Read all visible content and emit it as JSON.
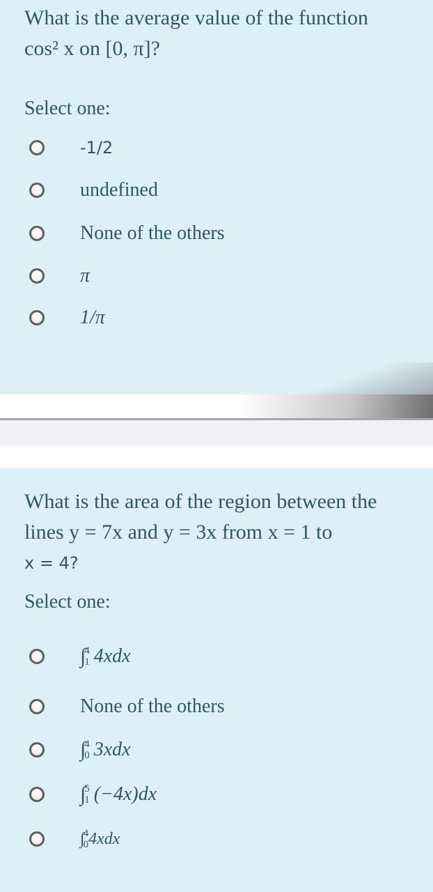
{
  "questions": [
    {
      "text_prefix": "What is the average value of the function",
      "text_math": "cos² x on [0, π]?",
      "select_label": "Select one:",
      "options": [
        {
          "label": "-1/2"
        },
        {
          "label": "undefined"
        },
        {
          "label": "None of the others"
        },
        {
          "label": "π"
        },
        {
          "label": "1/π"
        }
      ]
    },
    {
      "text_line1": "What is the area of the region between the",
      "text_line2": "lines y = 7x and y = 3x from x = 1 to",
      "text_line3": "x = 4?",
      "select_label": "Select one:",
      "options": [
        {
          "sign": "∫",
          "upper": "4",
          "lower": "1",
          "body": "4xdx"
        },
        {
          "label": "None of the others"
        },
        {
          "sign": "∫",
          "upper": "4",
          "lower": "0",
          "body": "3xdx"
        },
        {
          "sign": "∫",
          "upper": "5",
          "lower": "1",
          "body": "(−4x)dx"
        },
        {
          "sign": "∫",
          "upper": "4",
          "lower": "0",
          "body": "4xdx"
        }
      ]
    }
  ],
  "colors": {
    "question_bg": "#def0f7",
    "text": "#2f5761",
    "divider": "#a6a6a8"
  }
}
